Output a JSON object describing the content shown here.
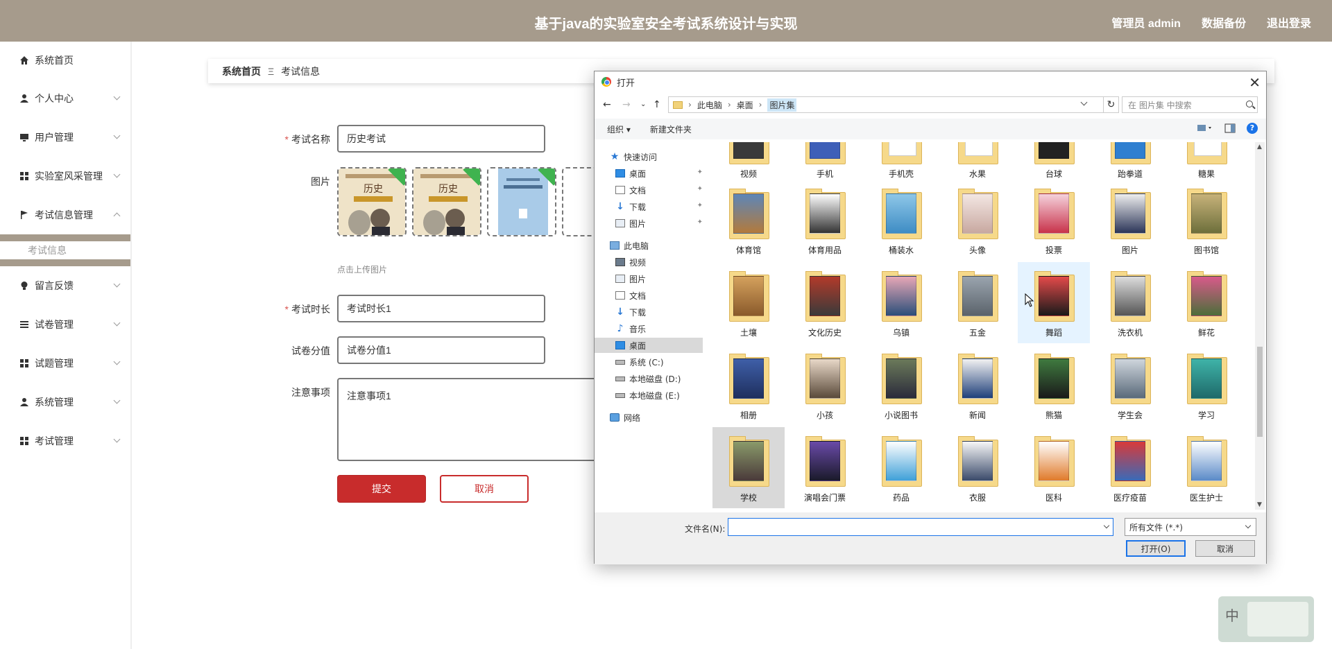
{
  "header": {
    "title": "基于java的实验室安全考试系统设计与实现",
    "nav": [
      "管理员 admin",
      "数据备份",
      "退出登录"
    ]
  },
  "sidebar": {
    "items": [
      {
        "label": "系统首页",
        "icon": "home-icon"
      },
      {
        "label": "个人中心",
        "icon": "user-icon"
      },
      {
        "label": "用户管理",
        "icon": "monitor-icon"
      },
      {
        "label": "实验室风采管理",
        "icon": "grid-icon"
      },
      {
        "label": "考试信息管理",
        "icon": "flag-icon"
      },
      {
        "label": "留言反馈",
        "icon": "bulb-icon"
      },
      {
        "label": "试卷管理",
        "icon": "list-icon"
      },
      {
        "label": "试题管理",
        "icon": "grid-icon"
      },
      {
        "label": "系统管理",
        "icon": "user-icon"
      },
      {
        "label": "考试管理",
        "icon": "grid-icon"
      }
    ],
    "submenu": "考试信息"
  },
  "breadcrumb": {
    "home": "系统首页",
    "sep": "Ξ",
    "current": "考试信息"
  },
  "form": {
    "name_label": "考试名称",
    "name_value": "历史考试",
    "image_label": "图片",
    "upload_hint": "点击上传图片",
    "duration_label": "考试时长",
    "duration_value": "考试时长1",
    "score_label": "试卷分值",
    "score_value": "试卷分值1",
    "notes_label": "注意事项",
    "notes_value": "注意事项1",
    "submit": "提交",
    "cancel": "取消"
  },
  "dialog": {
    "title": "打开",
    "path": [
      "此电脑",
      "桌面",
      "图片集"
    ],
    "search_placeholder": "在 图片集 中搜索",
    "toolbar": {
      "organize": "组织 ▾",
      "new_folder": "新建文件夹"
    },
    "nav": {
      "quick_access": "快速访问",
      "quick": [
        "桌面",
        "文档",
        "下载",
        "图片"
      ],
      "this_pc": "此电脑",
      "pc_items": [
        "视频",
        "图片",
        "文档",
        "下载",
        "音乐",
        "桌面",
        "系统 (C:)",
        "本地磁盘 (D:)",
        "本地磁盘 (E:)"
      ],
      "network": "网络"
    },
    "row0": [
      "视频",
      "手机",
      "手机壳",
      "水果",
      "台球",
      "跆拳道",
      "糖果"
    ],
    "row1": [
      "体育馆",
      "体育用品",
      "桶装水",
      "头像",
      "投票",
      "图片",
      "图书馆"
    ],
    "row2": [
      "土壤",
      "文化历史",
      "乌镇",
      "五金",
      "舞蹈",
      "洗衣机",
      "鲜花"
    ],
    "row3": [
      "相册",
      "小孩",
      "小说图书",
      "新闻",
      "熊猫",
      "学生会",
      "学习"
    ],
    "row4": [
      "学校",
      "演唱会门票",
      "药品",
      "衣服",
      "医科",
      "医疗疫苗",
      "医生护士"
    ],
    "filename_label": "文件名(N):",
    "filetype": "所有文件 (*.*)",
    "open": "打开(O)",
    "cancel": "取消"
  },
  "ime": {
    "label": "中"
  },
  "colors": {
    "header": "#a69b8c",
    "primary": "#c82c2c",
    "badge": "#3fb34f"
  }
}
